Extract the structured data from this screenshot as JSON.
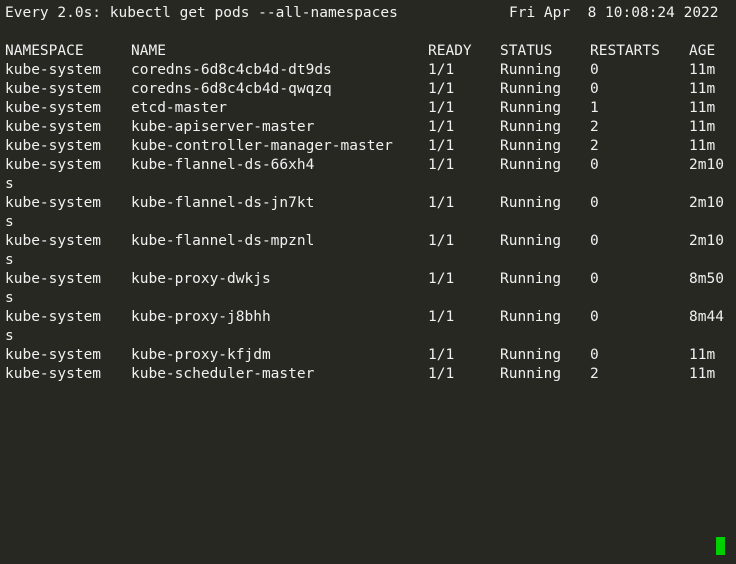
{
  "header": {
    "command": "Every 2.0s: kubectl get pods --all-namespaces",
    "datetime": "Fri Apr  8 10:08:24 2022"
  },
  "table": {
    "columns": [
      "NAMESPACE",
      "NAME",
      "READY",
      "STATUS",
      "RESTARTS",
      "AGE"
    ],
    "rows": [
      {
        "namespace": "kube-system",
        "name": "coredns-6d8c4cb4d-dt9ds",
        "ready": "1/1",
        "status": "Running",
        "restarts": "0",
        "age": "11m",
        "age_wrap": ""
      },
      {
        "namespace": "kube-system",
        "name": "coredns-6d8c4cb4d-qwqzq",
        "ready": "1/1",
        "status": "Running",
        "restarts": "0",
        "age": "11m",
        "age_wrap": ""
      },
      {
        "namespace": "kube-system",
        "name": "etcd-master",
        "ready": "1/1",
        "status": "Running",
        "restarts": "1",
        "age": "11m",
        "age_wrap": ""
      },
      {
        "namespace": "kube-system",
        "name": "kube-apiserver-master",
        "ready": "1/1",
        "status": "Running",
        "restarts": "2",
        "age": "11m",
        "age_wrap": ""
      },
      {
        "namespace": "kube-system",
        "name": "kube-controller-manager-master",
        "ready": "1/1",
        "status": "Running",
        "restarts": "2",
        "age": "11m",
        "age_wrap": ""
      },
      {
        "namespace": "kube-system",
        "name": "kube-flannel-ds-66xh4",
        "ready": "1/1",
        "status": "Running",
        "restarts": "0",
        "age": "2m10",
        "age_wrap": "s"
      },
      {
        "namespace": "kube-system",
        "name": "kube-flannel-ds-jn7kt",
        "ready": "1/1",
        "status": "Running",
        "restarts": "0",
        "age": "2m10",
        "age_wrap": "s"
      },
      {
        "namespace": "kube-system",
        "name": "kube-flannel-ds-mpznl",
        "ready": "1/1",
        "status": "Running",
        "restarts": "0",
        "age": "2m10",
        "age_wrap": "s"
      },
      {
        "namespace": "kube-system",
        "name": "kube-proxy-dwkjs",
        "ready": "1/1",
        "status": "Running",
        "restarts": "0",
        "age": "8m50",
        "age_wrap": "s"
      },
      {
        "namespace": "kube-system",
        "name": "kube-proxy-j8bhh",
        "ready": "1/1",
        "status": "Running",
        "restarts": "0",
        "age": "8m44",
        "age_wrap": "s"
      },
      {
        "namespace": "kube-system",
        "name": "kube-proxy-kfjdm",
        "ready": "1/1",
        "status": "Running",
        "restarts": "0",
        "age": "11m",
        "age_wrap": ""
      },
      {
        "namespace": "kube-system",
        "name": "kube-scheduler-master",
        "ready": "1/1",
        "status": "Running",
        "restarts": "2",
        "age": "11m",
        "age_wrap": ""
      }
    ]
  },
  "colors": {
    "background": "#272822",
    "foreground": "#f0f0f0",
    "cursor": "#00d000"
  }
}
